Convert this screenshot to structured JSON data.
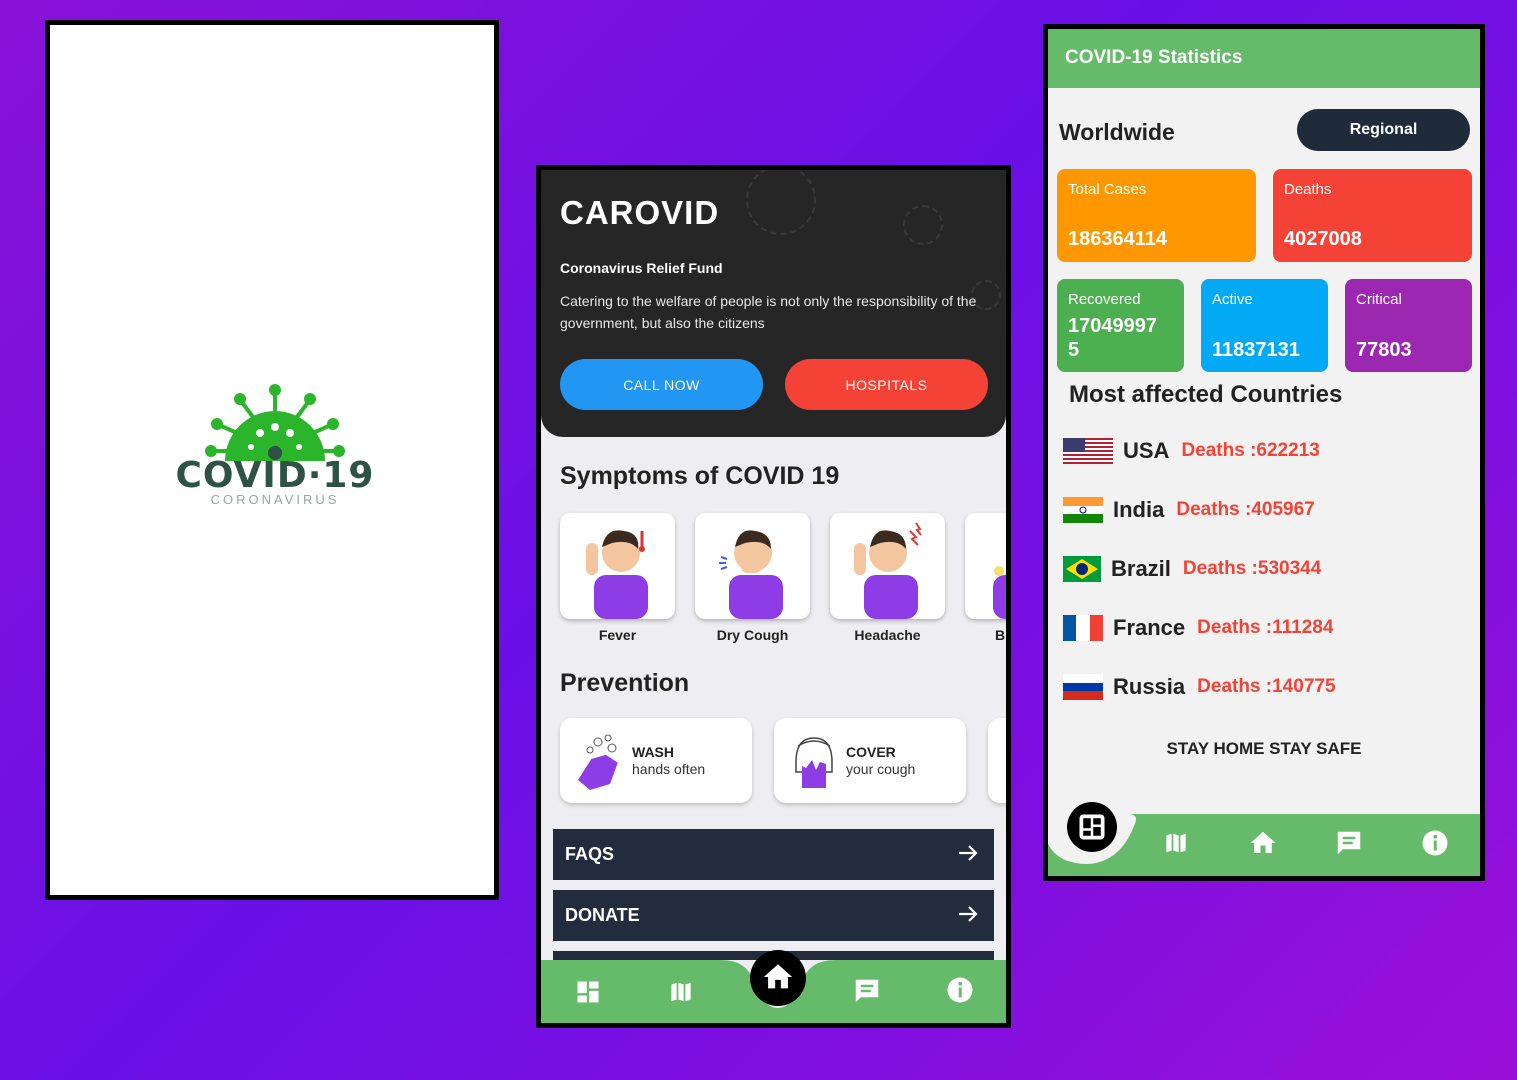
{
  "splash": {
    "logo_title": "COVID·19",
    "logo_subtitle": "CORONAVIRUS",
    "logo_color": "#2bb52b"
  },
  "home": {
    "app_title": "CAROVID",
    "fund_title": "Coronavirus Relief Fund",
    "fund_text": "Catering to the welfare of people is not only the responsibility of the government, but also the citizens",
    "call_button": "CALL NOW",
    "hospitals_button": "HOSPITALS",
    "symptoms_title": "Symptoms of COVID 19",
    "symptoms": [
      {
        "label": "Fever",
        "icon": "fever-icon"
      },
      {
        "label": "Dry Cough",
        "icon": "cough-icon"
      },
      {
        "label": "Headache",
        "icon": "headache-icon"
      },
      {
        "label": "B",
        "icon": "breathing-icon"
      }
    ],
    "prevention_title": "Prevention",
    "prevention": [
      {
        "title": "WASH",
        "subtitle": "hands often",
        "icon": "wash-hands-icon"
      },
      {
        "title": "COVER",
        "subtitle": "your cough",
        "icon": "cover-cough-icon"
      }
    ],
    "links": [
      {
        "label": "FAQS",
        "icon": "arrow-right-icon"
      },
      {
        "label": "DONATE",
        "icon": "arrow-right-icon"
      }
    ],
    "nav": [
      "dashboard-icon",
      "map-icon",
      "home-icon",
      "chat-icon",
      "info-icon"
    ]
  },
  "stats": {
    "header": "COVID-19 Statistics",
    "scope_label": "Worldwide",
    "regional_button": "Regional",
    "boxes": {
      "total": {
        "label": "Total Cases",
        "value": "186364114",
        "color": "#ff9800"
      },
      "deaths": {
        "label": "Deaths",
        "value": "4027008",
        "color": "#f44336"
      },
      "recovered": {
        "label": "Recovered",
        "value_line1": "17049997",
        "value_line2": "5",
        "color": "#4caf50"
      },
      "active": {
        "label": "Active",
        "value": "11837131",
        "color": "#03a9f4"
      },
      "critical": {
        "label": "Critical",
        "value": "77803",
        "color": "#9c27b0"
      }
    },
    "countries_title": "Most affected Countries",
    "countries": [
      {
        "name": "USA",
        "deaths": "Deaths :622213"
      },
      {
        "name": "India",
        "deaths": "Deaths :405967"
      },
      {
        "name": "Brazil",
        "deaths": "Deaths :530344"
      },
      {
        "name": "France",
        "deaths": "Deaths :111284"
      },
      {
        "name": "Russia",
        "deaths": "Deaths :140775"
      }
    ],
    "footer": "STAY HOME STAY SAFE",
    "nav": [
      "dashboard-icon",
      "map-icon",
      "home-icon",
      "chat-icon",
      "info-icon"
    ],
    "accent": "#66bb6a"
  }
}
